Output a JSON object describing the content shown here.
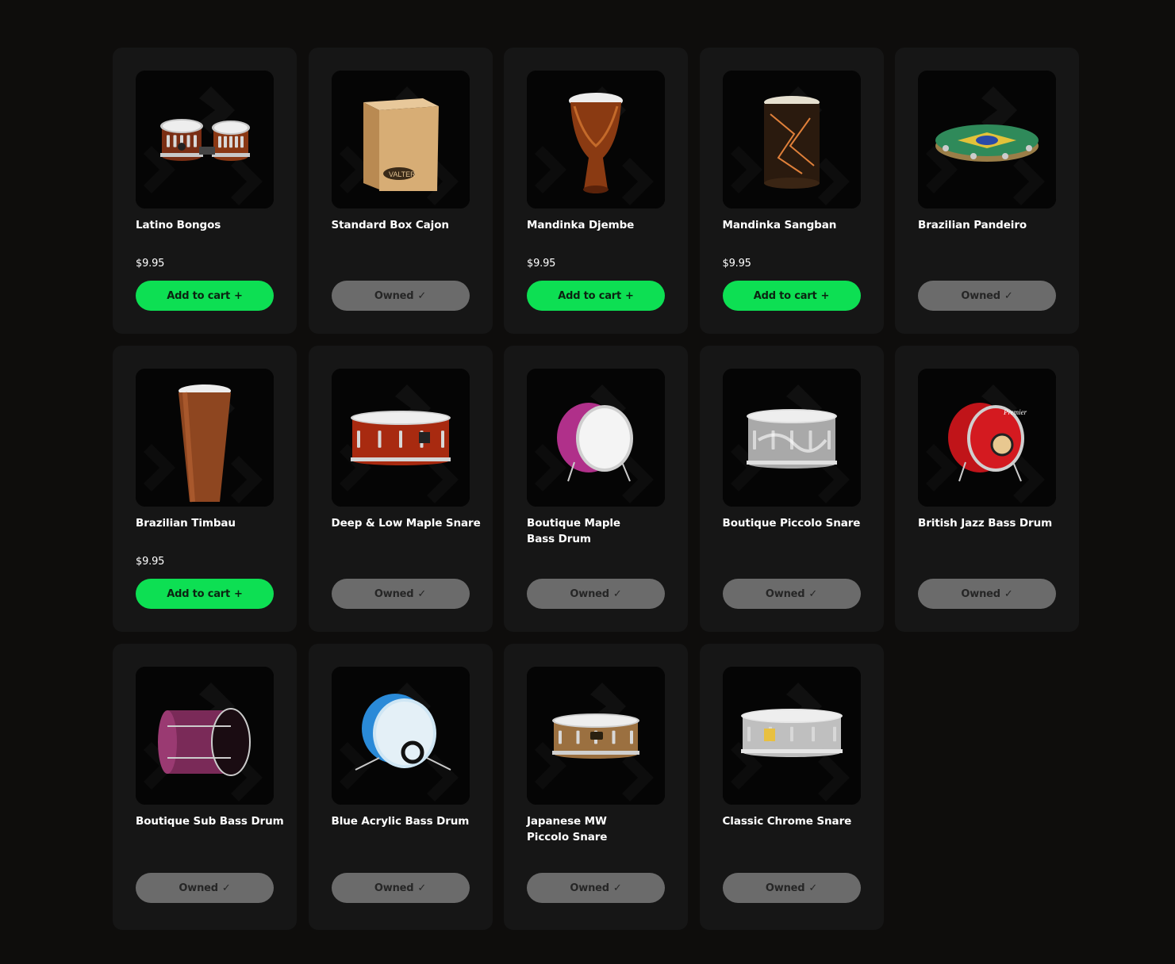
{
  "labels": {
    "add_to_cart": "Add to cart",
    "owned": "Owned"
  },
  "icons": {
    "add": "plus-icon",
    "owned": "checkmark-icon"
  },
  "colors": {
    "page_background": "#0e0d0c",
    "card_background": "#161616",
    "add_button": "#0ddf53",
    "owned_button": "#6b6b6b"
  },
  "products": [
    {
      "name": "Latino Bongos",
      "price": "$9.95",
      "status": "add",
      "kind": "bongos"
    },
    {
      "name": "Standard Box Cajon",
      "price": "",
      "status": "owned",
      "kind": "cajon"
    },
    {
      "name": "Mandinka Djembe",
      "price": "$9.95",
      "status": "add",
      "kind": "djembe"
    },
    {
      "name": "Mandinka Sangban",
      "price": "$9.95",
      "status": "add",
      "kind": "sangban"
    },
    {
      "name": "Brazilian Pandeiro",
      "price": "",
      "status": "owned",
      "kind": "pandeiro"
    },
    {
      "name": "Brazilian Timbau",
      "price": "$9.95",
      "status": "add",
      "kind": "timbau"
    },
    {
      "name": "Deep & Low Maple Snare",
      "price": "",
      "status": "owned",
      "kind": "snare-red"
    },
    {
      "name": "Boutique Maple\nBass Drum",
      "price": "",
      "status": "owned",
      "kind": "bass-pink"
    },
    {
      "name": "Boutique Piccolo Snare",
      "price": "",
      "status": "owned",
      "kind": "snare-chrome"
    },
    {
      "name": "British Jazz Bass Drum",
      "price": "",
      "status": "owned",
      "kind": "bass-red"
    },
    {
      "name": "Boutique Sub Bass Drum",
      "price": "",
      "status": "owned",
      "kind": "sub-bass"
    },
    {
      "name": "Blue Acrylic Bass Drum",
      "price": "",
      "status": "owned",
      "kind": "bass-blue"
    },
    {
      "name": "Japanese MW\nPiccolo Snare",
      "price": "",
      "status": "owned",
      "kind": "snare-wood"
    },
    {
      "name": "Classic Chrome Snare",
      "price": "",
      "status": "owned",
      "kind": "snare-classic"
    }
  ]
}
